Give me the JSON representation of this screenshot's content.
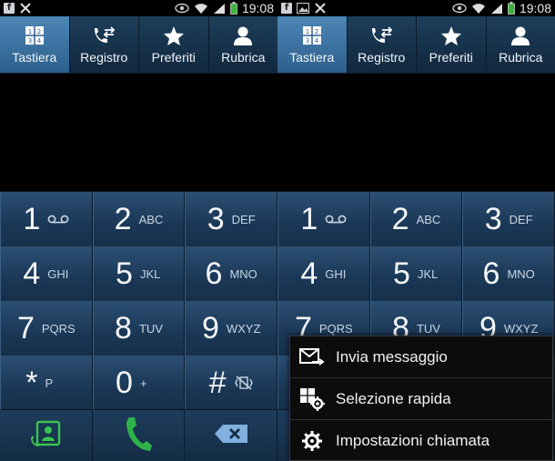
{
  "status_bar": {
    "time": "19:08",
    "fb_letter": "f"
  },
  "tabs": [
    {
      "label": "Tastiera",
      "active": true
    },
    {
      "label": "Registro",
      "active": false
    },
    {
      "label": "Preferiti",
      "active": false
    },
    {
      "label": "Rubrica",
      "active": false
    }
  ],
  "keypad": [
    [
      {
        "digit": "1",
        "letters": ""
      },
      {
        "digit": "2",
        "letters": "ABC"
      },
      {
        "digit": "3",
        "letters": "DEF"
      }
    ],
    [
      {
        "digit": "4",
        "letters": "GHI"
      },
      {
        "digit": "5",
        "letters": "JKL"
      },
      {
        "digit": "6",
        "letters": "MNO"
      }
    ],
    [
      {
        "digit": "7",
        "letters": "PQRS"
      },
      {
        "digit": "8",
        "letters": "TUV"
      },
      {
        "digit": "9",
        "letters": "WXYZ"
      }
    ],
    [
      {
        "digit": "*",
        "letters": "P"
      },
      {
        "digit": "0",
        "letters": "+"
      },
      {
        "digit": "#",
        "letters": ""
      }
    ]
  ],
  "context_menu": {
    "items": [
      {
        "label": "Invia messaggio",
        "icon": "message-send-icon"
      },
      {
        "label": "Selezione rapida",
        "icon": "speed-dial-icon"
      },
      {
        "label": "Impostazioni chiamata",
        "icon": "gear-icon"
      }
    ]
  },
  "colors": {
    "accent": "#3a74a6",
    "call_green": "#2fb24a",
    "key_bg": "#1f3f60"
  }
}
